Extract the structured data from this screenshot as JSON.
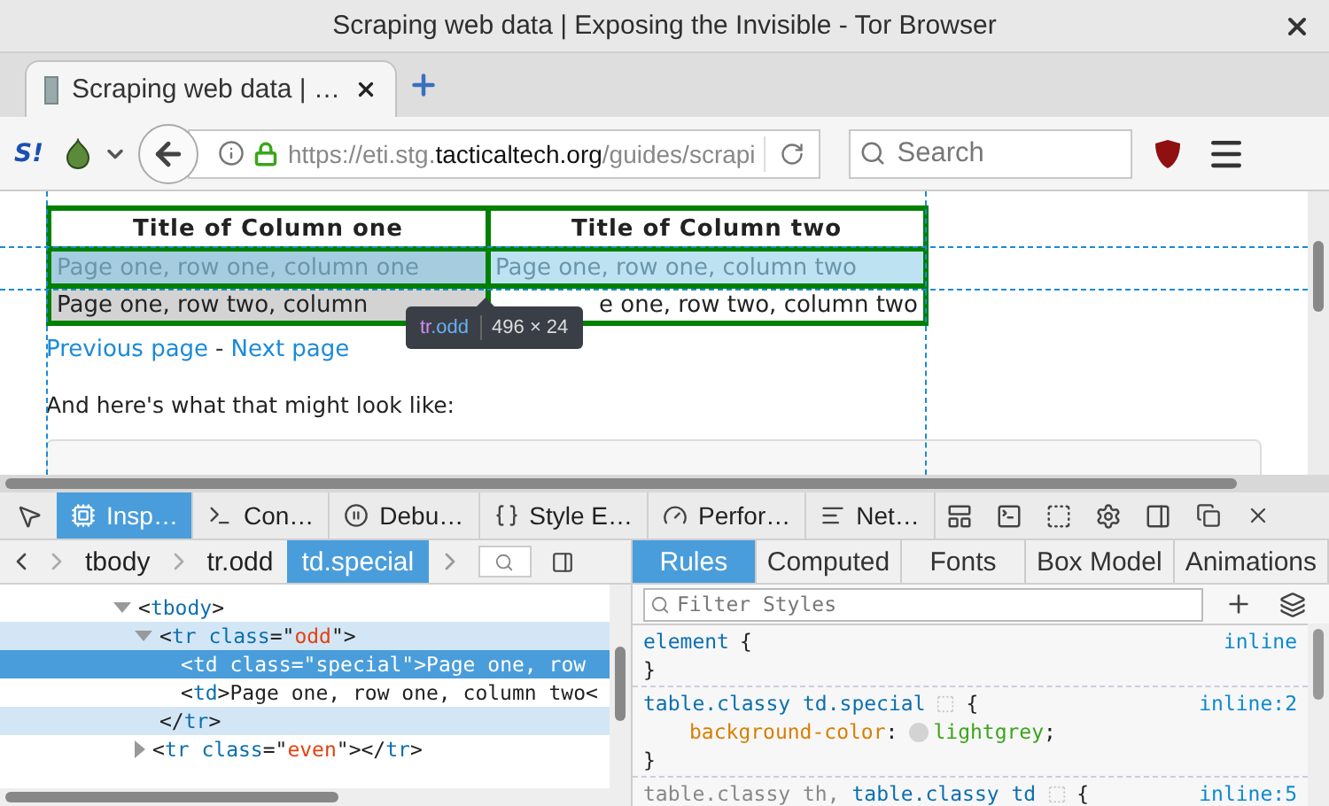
{
  "window": {
    "title": "Scraping web data | Exposing the Invisible - Tor Browser"
  },
  "tabs": [
    {
      "label": "Scraping web data | …",
      "selected": true
    }
  ],
  "navbar": {
    "badge": "S!",
    "url": {
      "prefix": "https://eti.stg.",
      "host": "tacticaltech.org",
      "path": "/guides/scrapi"
    },
    "search": {
      "placeholder": "Search"
    }
  },
  "page": {
    "table": {
      "columns": [
        "Title of Column one",
        "Title of Column two"
      ],
      "rows": [
        {
          "highlighted": true,
          "cells": [
            {
              "text": "Page one, row one, column one",
              "special": true
            },
            {
              "text": "Page one, row one, column two",
              "special": false
            }
          ]
        },
        {
          "highlighted": false,
          "cells": [
            {
              "text": "Page one, row two, column",
              "special": true
            },
            {
              "text": "e one, row two, column two",
              "special": false
            }
          ]
        }
      ]
    },
    "tooltip": {
      "tag": "tr",
      "class": ".odd",
      "size": "496 × 24"
    },
    "links": [
      {
        "kind": "link",
        "text": "Previous page"
      },
      {
        "kind": "sep",
        "text": "-"
      },
      {
        "kind": "link",
        "text": "Next page"
      }
    ],
    "paragraph": "And here's what that might look like:"
  },
  "devtools": {
    "tools": [
      {
        "kind": "inspector",
        "label": "Insp…",
        "selected": true
      },
      {
        "kind": "console",
        "label": "Con…",
        "selected": false
      },
      {
        "kind": "debugger",
        "label": "Debu…",
        "selected": false
      },
      {
        "kind": "style",
        "label": "Style E…",
        "selected": false
      },
      {
        "kind": "performance",
        "label": "Perfor…",
        "selected": false
      },
      {
        "kind": "network",
        "label": "Net…",
        "selected": false
      }
    ],
    "breadcrumbs": [
      {
        "label": "tbody",
        "selected": false
      },
      {
        "label": "tr.odd",
        "selected": false
      },
      {
        "label": "td.special",
        "selected": true
      }
    ],
    "sidebar_tabs": [
      {
        "label": "Rules",
        "selected": true
      },
      {
        "label": "Computed",
        "selected": false
      },
      {
        "label": "Fonts",
        "selected": false
      },
      {
        "label": "Box Model",
        "selected": false
      },
      {
        "label": "Animations",
        "selected": false
      }
    ],
    "markup": [
      {
        "expanded": true,
        "selected": false,
        "hovered": false,
        "open": [
          {
            "kind": "p",
            "text": "<"
          },
          {
            "kind": "tag",
            "text": "tbody"
          },
          {
            "kind": "p",
            "text": ">"
          }
        ],
        "children": [
          {
            "expanded": true,
            "selected": false,
            "hovered": true,
            "open": [
              {
                "kind": "p",
                "text": "<"
              },
              {
                "kind": "tag",
                "text": "tr"
              },
              {
                "kind": "attr",
                "text": " class"
              },
              {
                "kind": "p",
                "text": "=\""
              },
              {
                "kind": "val",
                "text": "odd"
              },
              {
                "kind": "p",
                "text": "\">"
              }
            ],
            "children": [
              {
                "selected": true,
                "hovered": false,
                "open": [
                  {
                    "kind": "p",
                    "text": "<"
                  },
                  {
                    "kind": "tag",
                    "text": "td"
                  },
                  {
                    "kind": "attr",
                    "text": " class"
                  },
                  {
                    "kind": "p",
                    "text": "=\""
                  },
                  {
                    "kind": "val",
                    "text": "special"
                  },
                  {
                    "kind": "p",
                    "text": "\">"
                  },
                  {
                    "kind": "text",
                    "text": "Page one, row"
                  }
                ]
              },
              {
                "selected": false,
                "hovered": false,
                "open": [
                  {
                    "kind": "p",
                    "text": "<"
                  },
                  {
                    "kind": "tag",
                    "text": "td"
                  },
                  {
                    "kind": "p",
                    "text": ">"
                  },
                  {
                    "kind": "text",
                    "text": "Page one, row one, column two<"
                  }
                ]
              }
            ],
            "close": [
              {
                "kind": "p",
                "text": "</"
              },
              {
                "kind": "tag",
                "text": "tr"
              },
              {
                "kind": "p",
                "text": ">"
              }
            ]
          },
          {
            "expanded": false,
            "selected": false,
            "hovered": false,
            "open": [
              {
                "kind": "p",
                "text": "<"
              },
              {
                "kind": "tag",
                "text": "tr"
              },
              {
                "kind": "attr",
                "text": " class"
              },
              {
                "kind": "p",
                "text": "=\""
              },
              {
                "kind": "val",
                "text": "even"
              },
              {
                "kind": "p",
                "text": "\"></"
              },
              {
                "kind": "tag",
                "text": "tr"
              },
              {
                "kind": "p",
                "text": ">"
              }
            ]
          }
        ]
      }
    ],
    "filter": {
      "placeholder": "Filter Styles"
    },
    "rules": [
      {
        "selector": [
          {
            "text": "element",
            "matched": true
          }
        ],
        "open": "{",
        "source": "inline",
        "editable": false,
        "close": "}"
      },
      {
        "selector": [
          {
            "text": "table.classy td.special",
            "matched": true
          }
        ],
        "open": "{",
        "source": "inline:2",
        "editable": true,
        "declarations": [
          {
            "property": "background-color",
            "colon": ":",
            "swatch": true,
            "value": "lightgrey",
            "semicolon": ";"
          }
        ],
        "close": "}"
      },
      {
        "selector": [
          {
            "text": "table.classy th",
            "matched": false
          },
          {
            "text": ", ",
            "matched": false
          },
          {
            "text": "table.classy td",
            "matched": true
          }
        ],
        "open": "{",
        "source": "inline:5",
        "editable": true
      }
    ]
  }
}
